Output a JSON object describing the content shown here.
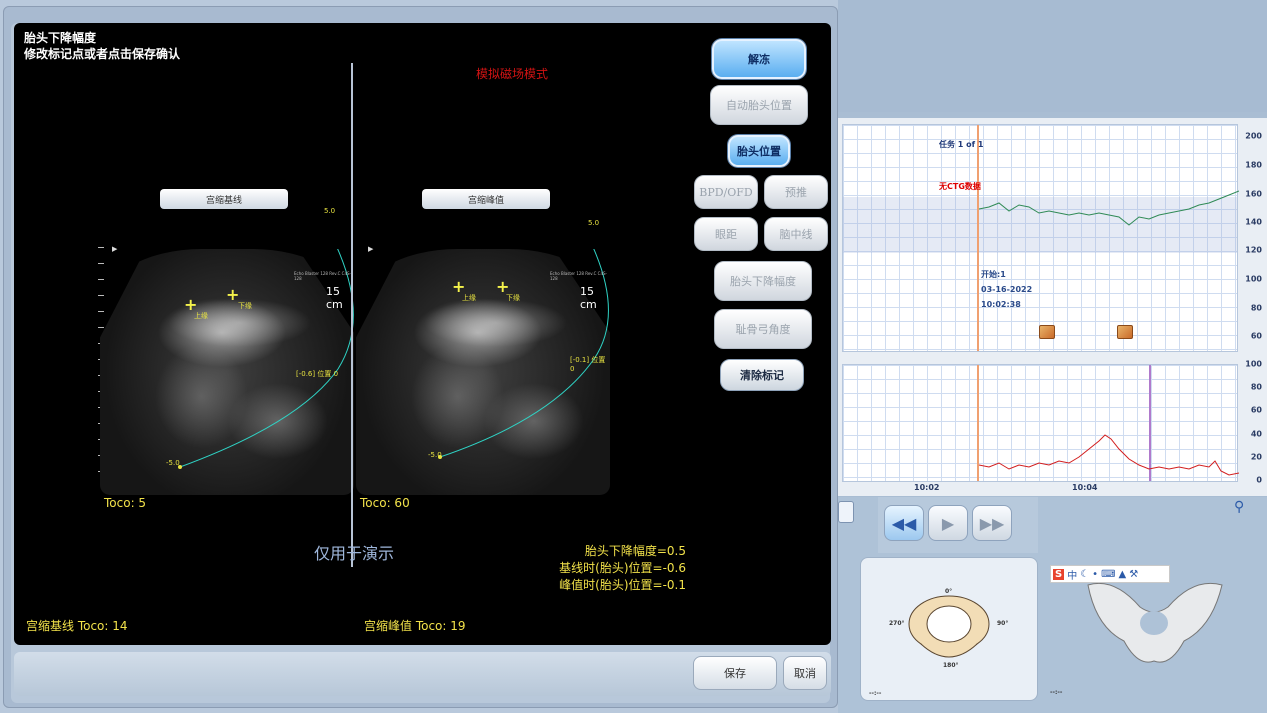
{
  "dialog": {
    "title": "胎头下降幅度",
    "subtitle": "修改标记点或者点击保存确认",
    "sim_mode": "模拟磁场模式",
    "watermark": "仅用于演示",
    "left_image": {
      "label": "宫缩基线",
      "depth": "15 cm",
      "probe": "Echo Blaster 128 Rev.C C4S-128",
      "top_marker": "5.0",
      "bottom_marker": "-5.0",
      "pos_label": "[-0.6] 位置 0",
      "point1": "上缘",
      "point2": "下缘",
      "toco": "Toco: 5"
    },
    "right_image": {
      "label": "宫缩峰值",
      "depth": "15 cm",
      "probe": "Echo Blaster 128 Rev.C C4S-128",
      "top_marker": "5.0",
      "bottom_marker": "-5.0",
      "pos_label": "[-0.1] 位置 0",
      "point1": "上缘",
      "point2": "下缘",
      "toco": "Toco: 60"
    },
    "results": {
      "descent": "胎头下降幅度=0.5",
      "baseline_pos": "基线时(胎头)位置=-0.6",
      "peak_pos": "峰值时(胎头)位置=-0.1"
    },
    "baseline_toco": "宫缩基线 Toco: 14",
    "peak_toco": "宫缩峰值 Toco: 19",
    "buttons": {
      "unfreeze": "解冻",
      "auto_head": "自动胎头位置",
      "head_pos": "胎头位置",
      "bpd_ofd": "BPD/OFD",
      "presentation": "预推",
      "eye_distance": "眼距",
      "midline": "脑中线",
      "head_descent": "胎头下降幅度",
      "pubic_angle": "耻骨弓角度",
      "clear_marks": "清除标记"
    },
    "footer": {
      "save": "保存",
      "cancel": "取消"
    }
  },
  "ctg": {
    "task": "任务 1 of 1",
    "no_data": "无CTG数据",
    "start_label": "开始:1",
    "date": "03-16-2022",
    "time": "10:02:38",
    "fhr_axis": [
      "200",
      "180",
      "160",
      "140",
      "120",
      "100",
      "80",
      "60"
    ],
    "toco_axis": [
      "100",
      "80",
      "60",
      "40",
      "20",
      "0"
    ],
    "time_ticks": [
      "10:02",
      "10:04"
    ],
    "colors": {
      "fhr": "#2f8a55",
      "toco": "#d21d1d",
      "start_marker": "#f0a070",
      "cursor": "#b07acc"
    }
  },
  "pelvis": {
    "angles": {
      "top": "0°",
      "right": "90°",
      "bottom": "180°",
      "left": "270°"
    },
    "footer_left": "--:--",
    "footer_right": "--:--"
  },
  "icons": [
    "rewind-icon",
    "play-icon",
    "fast-forward-icon",
    "zoom-in-icon",
    "ime-toolbar-icon"
  ]
}
